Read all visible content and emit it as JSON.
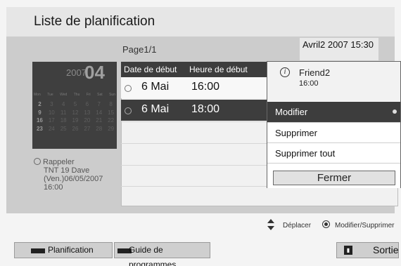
{
  "header": {
    "title": "Liste de planification"
  },
  "page_indicator": "Page1/1",
  "datetime": "Avril2 2007 15:30",
  "calendar": {
    "year": "2007",
    "month": "04",
    "weekdays": [
      "Mon",
      "Tue",
      "Wed",
      "Thu",
      "Fri",
      "Sat",
      "Sun"
    ],
    "rows": [
      [
        "2",
        "3",
        "4",
        "5",
        "6",
        "7",
        "8"
      ],
      [
        "9",
        "10",
        "11",
        "12",
        "13",
        "14",
        "15"
      ],
      [
        "16",
        "17",
        "18",
        "19",
        "20",
        "21",
        "22"
      ],
      [
        "23",
        "24",
        "25",
        "26",
        "27",
        "28",
        "29"
      ]
    ]
  },
  "reminder": {
    "label": "Rappeler",
    "channel": "TNT 19 Dave",
    "date": "(Ven.)06/05/2007",
    "time": "16:00"
  },
  "table": {
    "col_date": "Date de début",
    "col_time": "Heure de début",
    "rows": [
      {
        "date": "6 Mai",
        "time": "16:00"
      },
      {
        "date": "6 Mai",
        "time": "18:00"
      }
    ]
  },
  "popup": {
    "info_icon": "i",
    "name": "Friend2",
    "time": "16:00",
    "items": [
      "Modifier",
      "Supprimer",
      "Supprimer tout"
    ],
    "close_label": "Fermer"
  },
  "hints": {
    "move": "Déplacer",
    "edit": "Modifier/Supprimer"
  },
  "footer": {
    "planification": "Planification",
    "guide": "Guide de programmes",
    "exit": "Sortie"
  },
  "icons": {
    "clock": "clock-icon",
    "info": "info-icon",
    "updown": "up-down-arrow-icon",
    "ok": "ok-button-icon"
  }
}
